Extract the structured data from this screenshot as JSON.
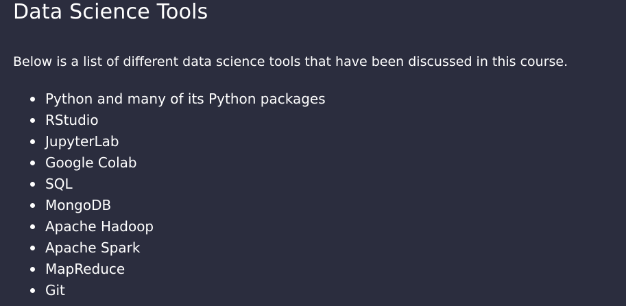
{
  "heading": "Data Science Tools",
  "intro": "Below is a list of different data science tools that have been discussed in this course.",
  "tools": [
    "Python and many of its Python packages",
    "RStudio",
    "JupyterLab",
    "Google Colab",
    "SQL",
    "MongoDB",
    "Apache Hadoop",
    "Apache Spark",
    "MapReduce",
    "Git"
  ],
  "colors": {
    "background": "#2b2d3e",
    "text": "#ffffff"
  }
}
